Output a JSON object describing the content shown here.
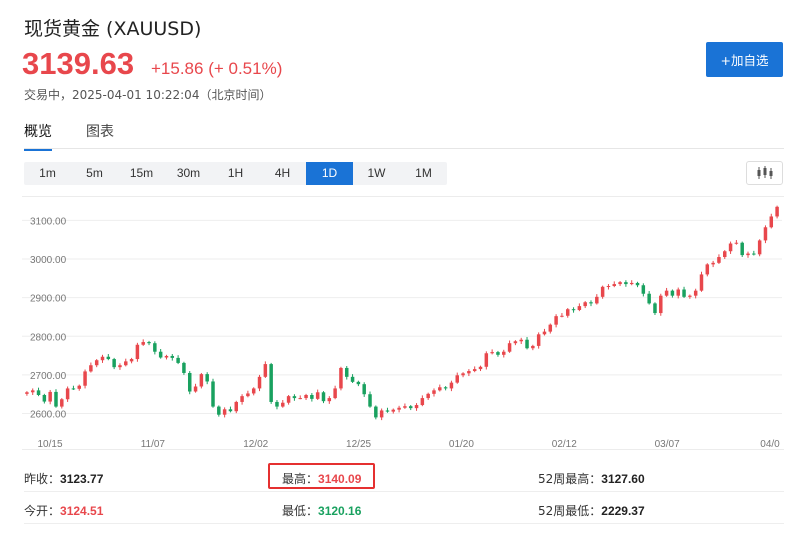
{
  "header": {
    "title": "现货黄金  (XAUUSD)",
    "price": "3139.63",
    "change": "+15.86 (+ 0.51%)",
    "status": "交易中，2025-04-01 10:22:04（北京时间）",
    "add_button": "+加自选"
  },
  "tabs": [
    {
      "label": "概览",
      "active": true
    },
    {
      "label": "图表",
      "active": false
    }
  ],
  "periods": [
    "1m",
    "5m",
    "15m",
    "30m",
    "1H",
    "4H",
    "1D",
    "1W",
    "1M"
  ],
  "active_period": "1D",
  "chart_type_icon": "candlestick-icon",
  "colors": {
    "up": "#e8474c",
    "down": "#19a15f",
    "accent": "#1a73d6"
  },
  "chart_data": {
    "type": "candlestick",
    "ylim": [
      2560,
      3150
    ],
    "y_ticks": [
      "2600.00",
      "2700.00",
      "2800.00",
      "2900.00",
      "3000.00",
      "3100.00"
    ],
    "x_ticks": [
      "10/15",
      "11/07",
      "12/02",
      "12/25",
      "01/20",
      "02/12",
      "03/07",
      "04/0"
    ],
    "closes": [
      2655,
      2660,
      2648,
      2631,
      2656,
      2618,
      2637,
      2665,
      2664,
      2672,
      2709,
      2725,
      2738,
      2747,
      2741,
      2720,
      2725,
      2735,
      2741,
      2778,
      2785,
      2782,
      2760,
      2745,
      2749,
      2744,
      2731,
      2705,
      2657,
      2670,
      2702,
      2683,
      2618,
      2597,
      2611,
      2606,
      2630,
      2645,
      2652,
      2665,
      2695,
      2728,
      2630,
      2618,
      2628,
      2645,
      2640,
      2640,
      2648,
      2638,
      2655,
      2632,
      2640,
      2665,
      2718,
      2695,
      2682,
      2676,
      2650,
      2618,
      2590,
      2608,
      2605,
      2610,
      2615,
      2619,
      2614,
      2622,
      2640,
      2651,
      2660,
      2668,
      2665,
      2680,
      2699,
      2704,
      2710,
      2715,
      2721,
      2756,
      2759,
      2752,
      2760,
      2782,
      2787,
      2791,
      2769,
      2775,
      2805,
      2812,
      2830,
      2852,
      2853,
      2870,
      2868,
      2878,
      2888,
      2885,
      2902,
      2928,
      2930,
      2935,
      2940,
      2935,
      2938,
      2932,
      2910,
      2885,
      2860,
      2905,
      2918,
      2905,
      2921,
      2902,
      2905,
      2918,
      2960,
      2986,
      2990,
      3005,
      3020,
      3040,
      3042,
      3010,
      3014,
      3012,
      3048,
      3082,
      3110,
      3135
    ]
  },
  "stats": [
    [
      {
        "label": "昨收：",
        "value": "3123.77",
        "color": "dark"
      },
      {
        "label": "最高：",
        "value": "3140.09",
        "color": "red",
        "highlighted": true
      },
      {
        "label": "52周最高：",
        "value": "3127.60",
        "color": "dark"
      }
    ],
    [
      {
        "label": "今开：",
        "value": "3124.51",
        "color": "red"
      },
      {
        "label": "最低：",
        "value": "3120.16",
        "color": "green"
      },
      {
        "label": "52周最低：",
        "value": "2229.37",
        "color": "dark"
      }
    ]
  ]
}
